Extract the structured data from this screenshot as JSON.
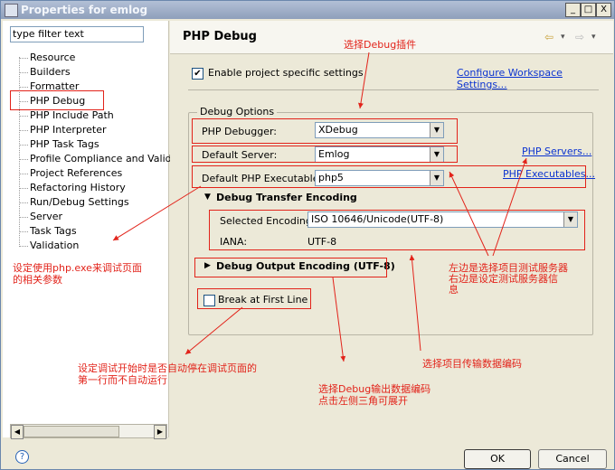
{
  "window": {
    "title": "Properties for emlog",
    "btn_min": "_",
    "btn_max": "□",
    "btn_close": "X"
  },
  "filter": {
    "value": "type filter text"
  },
  "tree": [
    "Resource",
    "Builders",
    "Formatter",
    "PHP Debug",
    "PHP Include Path",
    "PHP Interpreter",
    "PHP Task Tags",
    "Profile Compliance and Validatic",
    "Project References",
    "Refactoring History",
    "Run/Debug Settings",
    "Server",
    "Task Tags",
    "Validation"
  ],
  "header": {
    "title": "PHP Debug",
    "back_icon": "⇦",
    "forward_icon": "⇨",
    "menu_icon": "▾"
  },
  "settings": {
    "enable_label": "Enable project specific settings",
    "configure_link": "Configure Workspace Settings..."
  },
  "debug_options": {
    "title": "Debug Options",
    "debugger_label": "PHP Debugger:",
    "debugger_value": "XDebug",
    "server_label": "Default Server:",
    "server_value": "Emlog",
    "servers_link": "PHP Servers...",
    "exe_label": "Default PHP Executable:",
    "exe_value": "php5",
    "exes_link": "PHP Executables...",
    "transfer_title": "Debug Transfer Encoding",
    "selected_label": "Selected Encoding:",
    "selected_value": "ISO 10646/Unicode(UTF-8)",
    "iana_label": "IANA:",
    "iana_value": "UTF-8",
    "output_title": "Debug Output Encoding (UTF-8)",
    "break_label": "Break at First Line"
  },
  "buttons": {
    "ok": "OK",
    "cancel": "Cancel",
    "help": "?"
  },
  "annotations": {
    "select_plugin": "选择Debug插件",
    "php_exe": [
      "设定使用php.exe来调试页面",
      "的相关参数"
    ],
    "servers": [
      "左边是选择项目测试服务器",
      "右边是设定测试服务器信",
      "息"
    ],
    "break_first": [
      "设定调试开始时是否自动停在调试页面的",
      "第一行而不自动运行"
    ],
    "transfer_enc": "选择项目传输数据编码",
    "output_enc": [
      "选择Debug输出数据编码",
      "点击左侧三角可展开"
    ]
  },
  "colors": {
    "annotation": "#e2231a",
    "link": "#0b33d0"
  }
}
